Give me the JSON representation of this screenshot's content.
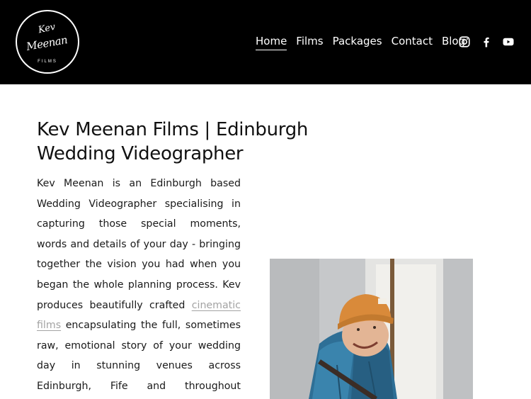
{
  "logo": {
    "line1": "Kev",
    "line2": "Meenan",
    "line3": "FILMS"
  },
  "nav": {
    "items": [
      {
        "label": "Home",
        "active": true
      },
      {
        "label": "Films",
        "active": false
      },
      {
        "label": "Packages",
        "active": false
      },
      {
        "label": "Contact",
        "active": false
      },
      {
        "label": "Blog",
        "active": false
      }
    ]
  },
  "social": [
    "instagram-icon",
    "facebook-icon",
    "youtube-icon"
  ],
  "main": {
    "title": "Kev Meenan Films | Edinburgh Wedding Videographer",
    "intro_before": "Kev Meenan is an Edinburgh based Wedding Videographer specialising in capturing those special moments, words and details of your day - bringing together the vision you had when you began the whole planning process. Kev produces beautifully crafted ",
    "intro_link": "cinematic films",
    "intro_after": " encapsulating the full, sometimes raw, emotional story of your wedding day in stunning venues across Edinburgh, Fife and throughout Scotland."
  },
  "colors": {
    "header_bg": "#000000",
    "link_grey": "#a3a3a3",
    "beanie": "#d98a3a",
    "jacket": "#2e6f96"
  }
}
